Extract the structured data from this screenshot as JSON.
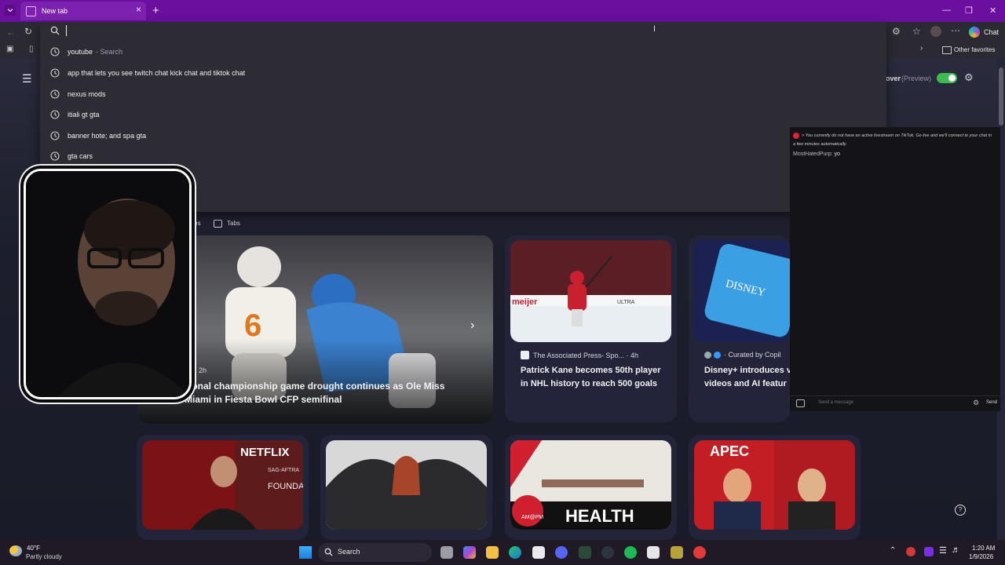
{
  "browser": {
    "tab_title": "New tab",
    "new_tab_symbol": "+",
    "tab_close_symbol": "×",
    "chat_label": "Chat",
    "other_favorites": "Other favorites",
    "address_text": ""
  },
  "suggestions": [
    {
      "text": "youtube",
      "sub": "- Search"
    },
    {
      "text": "app that lets you see twitch chat kick chat and tiktok chat",
      "sub": ""
    },
    {
      "text": "nexus mods",
      "sub": ""
    },
    {
      "text": "itiali gt gta",
      "sub": ""
    },
    {
      "text": "banner hote; and spa gta",
      "sub": ""
    },
    {
      "text": "gta cars",
      "sub": ""
    }
  ],
  "page": {
    "discover_label": "over",
    "preview_label": "(Preview)",
    "tab_favorites": "orites",
    "tab_tabs": "Tabs",
    "hero": {
      "meta": "orts · 2h",
      "title_line1": "national championship game drought continues as Ole Miss",
      "title_line2": "falls to Miami in Fiesta Bowl CFP semifinal"
    },
    "card2": {
      "source": "The Associated Press- Spo... · 4h",
      "title": "Patrick Kane becomes 50th player in NHL history to reach 500 goals",
      "image_text_left": "meijer",
      "image_text_right": "ULTRA"
    },
    "card3": {
      "source": "· Curated by Copil",
      "title_line1": "Disney+ introduces v",
      "title_line2": "videos and AI featur",
      "image_text": "DISNEY"
    },
    "row2": {
      "netflix_text": "NETFLIX",
      "sag_text": "SAG-AFTRA",
      "foundation_text": "FOUNDATI",
      "health_text": "HEALTH",
      "am_pm_text": "AM@PM",
      "apec_text": "APEC"
    }
  },
  "chat_overlay": {
    "system_message": "> You currently do not have an active livestream on TikTok. Go live and we'll connect to your chat in a few minutes automatically.",
    "user": "MostHatedPurp:",
    "message": "yo",
    "input_placeholder": "Send a message",
    "send_label": "Send"
  },
  "taskbar": {
    "weather_temp": "40°F",
    "weather_desc": "Partly cloudy",
    "search_label": "Search",
    "time": "1:20 AM",
    "date": "1/9/2026"
  },
  "colors": {
    "titlebar": "#6a0f9e",
    "toggle_green": "#3dbb4f"
  }
}
